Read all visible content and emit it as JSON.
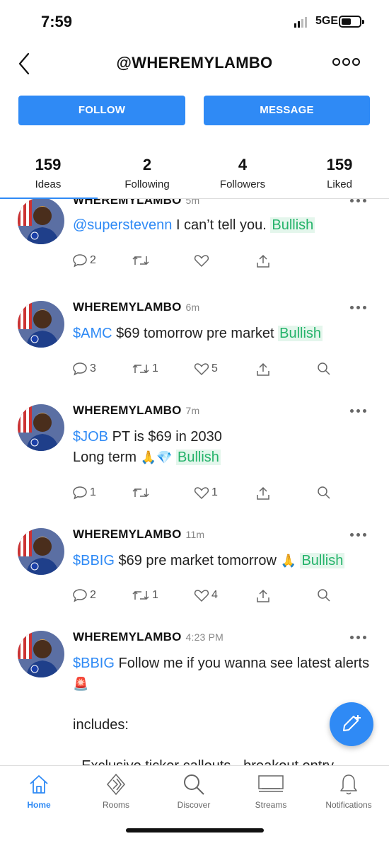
{
  "status": {
    "time": "7:59",
    "network": "5GE"
  },
  "header": {
    "title": "@WHEREMYLAMBO"
  },
  "buttons": {
    "follow": "FOLLOW",
    "message": "MESSAGE"
  },
  "stats": [
    {
      "value": "159",
      "label": "Ideas"
    },
    {
      "value": "2",
      "label": "Following"
    },
    {
      "value": "4",
      "label": "Followers"
    },
    {
      "value": "159",
      "label": "Liked"
    }
  ],
  "posts": [
    {
      "author": "WHEREMYLAMBO",
      "time": "5m",
      "mention": "@superstevenn",
      "text": " I can’t tell you. ",
      "sentiment": "Bullish",
      "comments": "2",
      "reshares": "",
      "likes": ""
    },
    {
      "author": "WHEREMYLAMBO",
      "time": "6m",
      "ticker": "$AMC",
      "text": " $69 tomorrow pre market ",
      "sentiment": "Bullish",
      "comments": "3",
      "reshares": "1",
      "likes": "5"
    },
    {
      "author": "WHEREMYLAMBO",
      "time": "7m",
      "ticker": "$JOB",
      "text": " PT is $69 in 2030",
      "line2": "Long term ",
      "emoji": "🙏💎",
      "sentiment": "Bullish",
      "comments": "1",
      "reshares": "",
      "likes": "1"
    },
    {
      "author": "WHEREMYLAMBO",
      "time": "11m",
      "ticker": "$BBIG",
      "text": " $69 pre market tomorrow ",
      "emoji": "🙏",
      "sentiment": "Bullish",
      "comments": "2",
      "reshares": "1",
      "likes": "4"
    },
    {
      "author": "WHEREMYLAMBO",
      "time": "4:23 PM",
      "ticker": "$BBIG",
      "text": " Follow me if you wanna see latest alerts ",
      "emoji": "🚨",
      "line3": "includes:",
      "line4": "- Exclusive ticker callouts - breakout entry"
    }
  ],
  "tabs": [
    {
      "label": "Home",
      "icon": "home-icon",
      "active": true
    },
    {
      "label": "Rooms",
      "icon": "rooms-icon"
    },
    {
      "label": "Discover",
      "icon": "search-icon"
    },
    {
      "label": "Streams",
      "icon": "streams-icon"
    },
    {
      "label": "Notifications",
      "icon": "bell-icon"
    }
  ],
  "colors": {
    "accent": "#2f8af5",
    "bullish": "#24b36a",
    "bullish_bg": "#e4f6ec"
  }
}
